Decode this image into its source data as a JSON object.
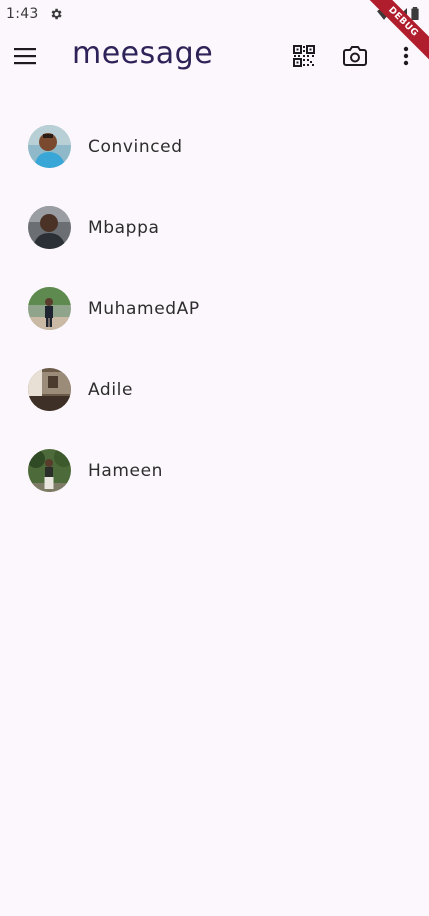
{
  "status_bar": {
    "time": "1:43"
  },
  "debug_banner": {
    "label": "DEBUG"
  },
  "app_bar": {
    "title": "meesage",
    "icons": [
      "menu-icon",
      "qr-code-icon",
      "camera-icon",
      "more-vert-icon"
    ]
  },
  "chats": [
    {
      "name": "Convinced"
    },
    {
      "name": "Mbappa"
    },
    {
      "name": "MuhamedAP"
    },
    {
      "name": "Adile"
    },
    {
      "name": "Hameen"
    }
  ],
  "colors": {
    "background": "#fcf7fd",
    "title": "#2e2358",
    "debug": "#b01d2d"
  }
}
